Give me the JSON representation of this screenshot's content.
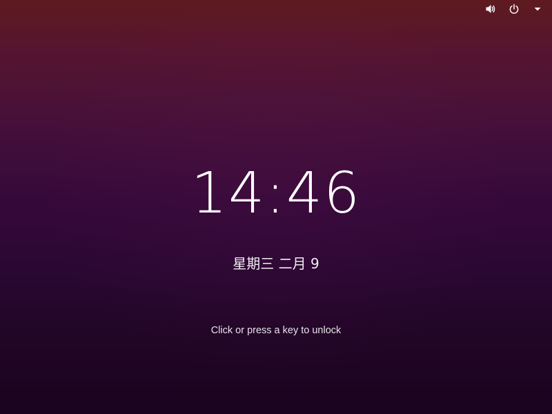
{
  "lock_screen": {
    "time": "14:46",
    "date": "星期三 二月 9",
    "unlock_hint": "Click or press a key to unlock"
  },
  "top_bar": {
    "icons": [
      "volume-icon",
      "power-icon",
      "dropdown-arrow-icon"
    ]
  },
  "colors": {
    "background_top": "#5f1a1f",
    "background_mid": "#36093a",
    "background_bottom": "#1a041e",
    "text": "#ffffff"
  }
}
